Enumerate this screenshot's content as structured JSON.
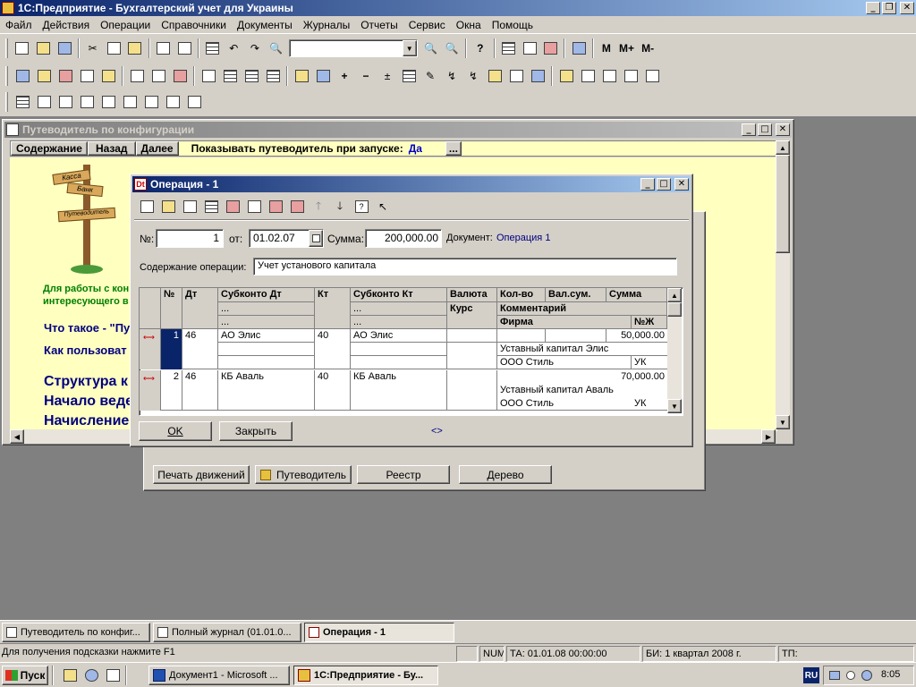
{
  "app": {
    "title": "1С:Предприятие - Бухгалтерский учет для Украины",
    "menu": [
      "Файл",
      "Действия",
      "Операции",
      "Справочники",
      "Документы",
      "Журналы",
      "Отчеты",
      "Сервис",
      "Окна",
      "Помощь"
    ],
    "toolbar_m": [
      "M",
      "M+",
      "M-"
    ]
  },
  "guide": {
    "title": "Путеводитель по конфигурации",
    "nav": [
      "Содержание",
      "Назад",
      "Далее"
    ],
    "show_label": "Показывать путеводитель при запуске:",
    "show_value": "Да",
    "more": "...",
    "hint_line1": "Для работы с кон",
    "hint_line2": "интересующего в",
    "link1": "Что такое - \"Пу",
    "link2": "Как пользоват",
    "big1": "Структура к",
    "big2": "Начало веде",
    "big3": "Начисление",
    "sign1": "Касса",
    "sign2": "Банк",
    "sign3": "Путеводитель"
  },
  "journal": {
    "buttons": [
      "Печать движений",
      "Путеводитель",
      "Реестр",
      "Дерево"
    ]
  },
  "operation": {
    "title": "Операция - 1",
    "num_label": "№:",
    "num_value": "1",
    "from_label": "от:",
    "date_value": "01.02.07",
    "sum_label": "Сумма:",
    "sum_value": "200,000.00",
    "doc_label": "Документ:",
    "doc_value": "Операция 1",
    "content_label": "Содержание операции:",
    "content_value": "Учет установого капитала",
    "headers": {
      "num": "№",
      "dt": "Дт",
      "sub_dt": "Субконто Дт",
      "kt": "Кт",
      "sub_kt": "Субконто Кт",
      "currency": "Валюта",
      "rate": "Курс",
      "qty": "Кол-во",
      "valsum": "Вал.сум.",
      "sum": "Сумма",
      "comment": "Комментарий",
      "firm": "Фирма",
      "nzh": "№Ж",
      "dots": "..."
    },
    "rows": [
      {
        "num": "1",
        "dt": "46",
        "sub_dt": "АО Элис",
        "kt": "40",
        "sub_kt": "АО Элис",
        "sum": "50,000.00",
        "comment": "Уставный капитал Элис",
        "firm": "ООО Стиль",
        "nzh": "УК"
      },
      {
        "num": "2",
        "dt": "46",
        "sub_dt": "КБ Аваль",
        "kt": "40",
        "sub_kt": "КБ Аваль",
        "sum": "70,000.00",
        "comment": "Уставный капитал Аваль",
        "firm": "ООО Стиль",
        "nzh": "УК"
      }
    ],
    "ok": "OK",
    "close": "Закрыть",
    "nav_marker": "<>"
  },
  "windows_bar": [
    "Путеводитель по конфиг...",
    "Полный журнал (01.01.0...",
    "Операция - 1"
  ],
  "status": {
    "hint": "Для получения подсказки нажмите F1",
    "num": "NUM",
    "ta": "ТА: 01.01.08  00:00:00",
    "bi": "БИ: 1 квартал 2008 г.",
    "tp": "ТП:"
  },
  "taskbar": {
    "start": "Пуск",
    "tasks": [
      "Документ1 - Microsoft ...",
      "1С:Предприятие - Бу..."
    ],
    "lang": "RU",
    "clock": "8:05"
  }
}
